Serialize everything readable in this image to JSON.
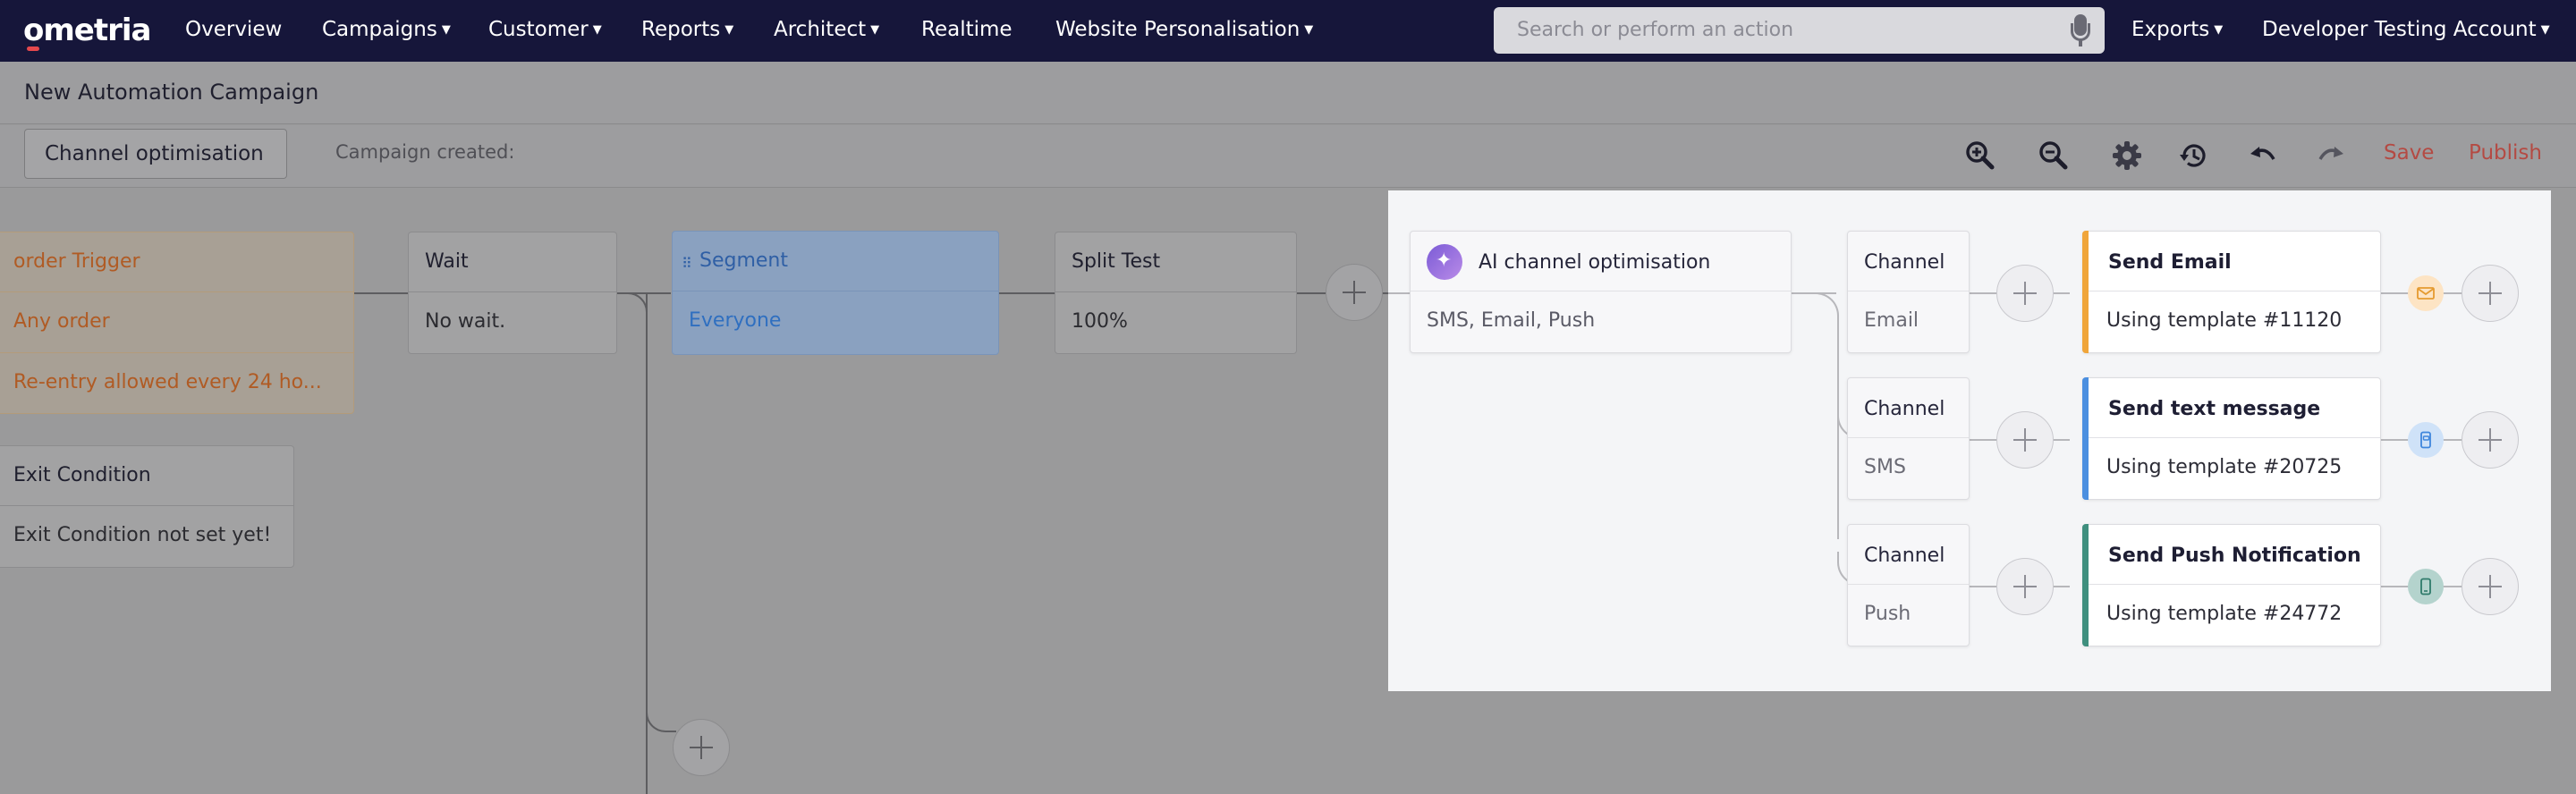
{
  "nav": {
    "logo": "ometria",
    "items": [
      {
        "label": "Overview",
        "caret": false
      },
      {
        "label": "Campaigns",
        "caret": true
      },
      {
        "label": "Customer",
        "caret": true
      },
      {
        "label": "Reports",
        "caret": true
      },
      {
        "label": "Architect",
        "caret": true
      },
      {
        "label": "Realtime",
        "caret": false
      },
      {
        "label": "Website Personalisation",
        "caret": true
      }
    ],
    "search_placeholder": "Search or perform an action",
    "exports": "Exports",
    "account": "Developer Testing Account"
  },
  "header": {
    "title": "New Automation Campaign",
    "campaign_name": "Channel optimisation",
    "campaign_created": "Campaign created:",
    "save": "Save",
    "publish": "Publish"
  },
  "canvas": {
    "trigger": {
      "title": "order Trigger",
      "line1": "Any order",
      "line2": "Re-entry allowed every 24 ho..."
    },
    "exit": {
      "title": "Exit Condition",
      "body": "Exit Condition not set yet!"
    },
    "wait": {
      "title": "Wait",
      "body": "No wait."
    },
    "segment": {
      "title": "Segment",
      "body": "Everyone"
    },
    "split": {
      "title": "Split Test",
      "body": "100%"
    },
    "ai": {
      "title": "AI channel optimisation",
      "body": "SMS, Email, Push"
    },
    "branches": [
      {
        "channel_title": "Channel",
        "channel": "Email",
        "action": "Send Email",
        "template": "Using template #11120",
        "color": "#f0a53a",
        "icon": "envelope-icon"
      },
      {
        "channel_title": "Channel",
        "channel": "SMS",
        "action": "Send text message",
        "template": "Using template #20725",
        "color": "#4b8fe0",
        "icon": "phone-message-icon"
      },
      {
        "channel_title": "Channel",
        "channel": "Push",
        "action": "Send Push Notification",
        "template": "Using template #24772",
        "color": "#3f8f7e",
        "icon": "mobile-push-icon"
      }
    ]
  },
  "colors": {
    "nav_bg": "#16163a",
    "accent_red": "#b44a43",
    "trigger_orange": "#c7662a",
    "segment_blue": "#2f6fc0"
  }
}
